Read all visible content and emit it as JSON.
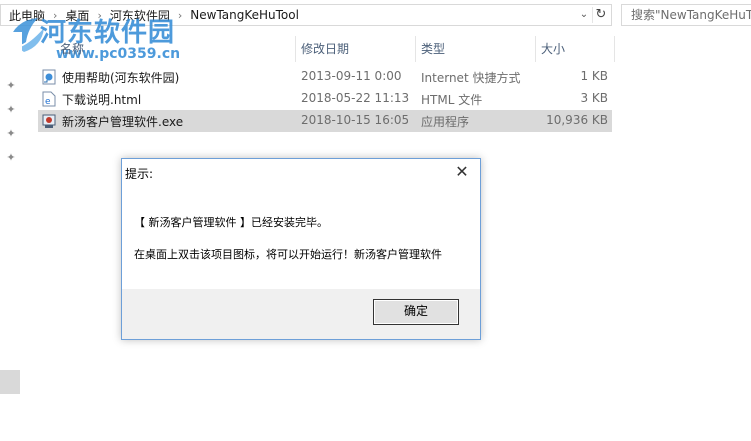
{
  "address": {
    "crumbs": [
      "此电脑",
      "桌面",
      "河东软件园",
      "NewTangKeHuTool"
    ],
    "search_placeholder": "搜索\"NewTangKeHuTool\""
  },
  "watermark": {
    "title": "河东软件园",
    "url": "www.pc0359.cn"
  },
  "columns": {
    "name": "名称",
    "date": "修改日期",
    "type": "类型",
    "size": "大小"
  },
  "files": [
    {
      "name": "使用帮助(河东软件园)",
      "date": "2013-09-11 0:00",
      "type": "Internet 快捷方式",
      "size": "1 KB",
      "icon": "internet-shortcut-icon"
    },
    {
      "name": "下载说明.html",
      "date": "2018-05-22 11:13",
      "type": "HTML 文件",
      "size": "3 KB",
      "icon": "html-file-icon"
    },
    {
      "name": "新汤客户管理软件.exe",
      "date": "2018-10-15 16:05",
      "type": "应用程序",
      "size": "10,936 KB",
      "icon": "exe-app-icon",
      "selected": true
    }
  ],
  "dialog": {
    "title": "提示:",
    "line1": "【 新汤客户管理软件 】已经安装完毕。",
    "line2": "在桌面上双击该项目图标，将可以开始运行！新汤客户管理软件",
    "ok": "确定"
  },
  "colors": {
    "accent": "#3a90d8",
    "selection": "#d9d9d9",
    "dialog_border": "#6d9fd8"
  }
}
